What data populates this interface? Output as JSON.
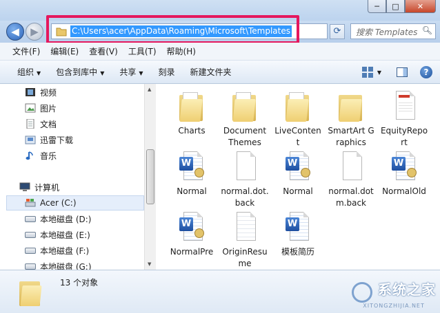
{
  "window": {
    "minimize": "─",
    "maximize": "□",
    "close": "✕"
  },
  "address": {
    "path": "C:\\Users\\acer\\AppData\\Roaming\\Microsoft\\Templates",
    "search_placeholder": "搜索 Templates"
  },
  "menu": [
    "文件(F)",
    "编辑(E)",
    "查看(V)",
    "工具(T)",
    "帮助(H)"
  ],
  "toolbar": {
    "organize": "组织",
    "include_library": "包含到库中",
    "share": "共享",
    "burn": "刻录",
    "new_folder": "新建文件夹"
  },
  "nav": {
    "favorites": [
      {
        "label": "视频",
        "icon": "video-icon"
      },
      {
        "label": "图片",
        "icon": "picture-icon"
      },
      {
        "label": "文档",
        "icon": "document-icon"
      },
      {
        "label": "迅雷下载",
        "icon": "download-icon"
      },
      {
        "label": "音乐",
        "icon": "music-icon"
      }
    ],
    "computer": "计算机",
    "drives": [
      "Acer (C:)",
      "本地磁盘 (D:)",
      "本地磁盘 (E:)",
      "本地磁盘 (F:)",
      "本地磁盘 (G:)"
    ]
  },
  "files": [
    {
      "name": "Charts",
      "type": "folder"
    },
    {
      "name": "Document Themes",
      "type": "folder"
    },
    {
      "name": "LiveContent",
      "type": "folder"
    },
    {
      "name": "SmartArt Graphics",
      "type": "folder"
    },
    {
      "name": "EquityReport",
      "type": "red-doc"
    },
    {
      "name": "Normal",
      "type": "word"
    },
    {
      "name": "normal.dot.back",
      "type": "blank"
    },
    {
      "name": "Normal",
      "type": "word"
    },
    {
      "name": "normal.dotm.back",
      "type": "blank"
    },
    {
      "name": "NormalOld",
      "type": "word"
    },
    {
      "name": "NormalPre",
      "type": "word"
    },
    {
      "name": "OriginResume",
      "type": "origin"
    },
    {
      "name": "模板简历",
      "type": "word"
    }
  ],
  "status": {
    "count": "13 个对象"
  },
  "watermark": {
    "title": "系统之家",
    "url": "XITONGZHIJIA.NET"
  },
  "colors": {
    "highlight_box": "#e5185e",
    "selection": "#3399ff"
  }
}
